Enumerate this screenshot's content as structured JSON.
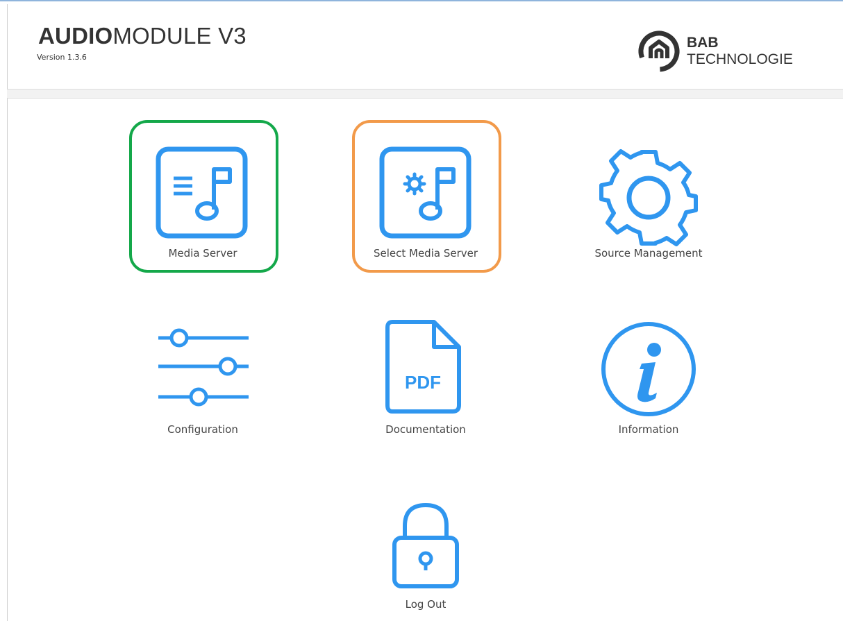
{
  "header": {
    "title_bold": "AUDIO",
    "title_light": "MODULE V3",
    "version": "Version 1.3.6",
    "brand_line1": "BAB",
    "brand_line2": "TECHNOLOGIE"
  },
  "tiles": [
    {
      "label": "Media Server",
      "icon": "media-server-icon",
      "highlight": "#14a84a"
    },
    {
      "label": "Select Media Server",
      "icon": "select-media-server-icon",
      "highlight": "#f29a4a"
    },
    {
      "label": "Source Management",
      "icon": "gear-icon"
    },
    {
      "label": "Configuration",
      "icon": "sliders-icon"
    },
    {
      "label": "Documentation",
      "icon": "pdf-document-icon",
      "icon_text": "PDF"
    },
    {
      "label": "Information",
      "icon": "info-icon"
    },
    {
      "label": "Log Out",
      "icon": "lock-icon"
    }
  ],
  "colors": {
    "icon": "#2f96ef",
    "text": "#333333",
    "highlight_green": "#14a84a",
    "highlight_orange": "#f29a4a"
  }
}
